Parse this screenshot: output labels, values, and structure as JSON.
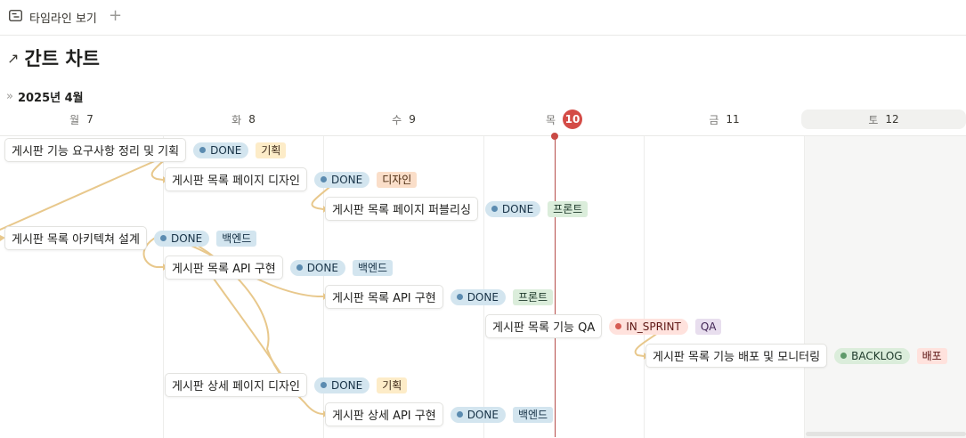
{
  "toolbar": {
    "view_tab_label": "타임라인 보기",
    "add_view_symbol": "+"
  },
  "page": {
    "title_arrow": "↗",
    "title": "간트 차트"
  },
  "timeline": {
    "collapse_symbol": "»",
    "month_label": "2025년 4월",
    "days": [
      {
        "weekday": "월",
        "day": "7"
      },
      {
        "weekday": "화",
        "day": "8"
      },
      {
        "weekday": "수",
        "day": "9"
      },
      {
        "weekday": "목",
        "day": "10",
        "today": true
      },
      {
        "weekday": "금",
        "day": "11"
      },
      {
        "weekday": "토",
        "day": "12",
        "weekend": true
      }
    ]
  },
  "tasks": [
    {
      "title": "게시판 기능 요구사항 정리 및 기획",
      "status": "DONE",
      "tag": "기획"
    },
    {
      "title": "게시판 목록 페이지 디자인",
      "status": "DONE",
      "tag": "디자인"
    },
    {
      "title": "게시판 목록 페이지 퍼블리싱",
      "status": "DONE",
      "tag": "프론트"
    },
    {
      "title": "게시판 목록 아키텍쳐 설계",
      "status": "DONE",
      "tag": "백엔드"
    },
    {
      "title": "게시판 목록 API 구현",
      "status": "DONE",
      "tag": "백엔드"
    },
    {
      "title": "게시판 목록 API 구현",
      "status": "DONE",
      "tag": "프론트"
    },
    {
      "title": "게시판 목록 기능 QA",
      "status": "IN_SPRINT",
      "tag": "QA"
    },
    {
      "title": "게시판 목록 기능 배포 및 모니터링",
      "status": "BACKLOG",
      "tag": "배포"
    },
    {
      "title": "게시판 상세 페이지 디자인",
      "status": "DONE",
      "tag": "기획"
    },
    {
      "title": "게시판 상세 API 구현",
      "status": "DONE",
      "tag": "백엔드"
    }
  ],
  "colors": {
    "today_marker": "#d44c47",
    "dependency_line": "#e8c88c",
    "status_done": "#d3e5ef",
    "status_in_sprint": "#ffe2dd",
    "status_backlog": "#dbeddb"
  }
}
